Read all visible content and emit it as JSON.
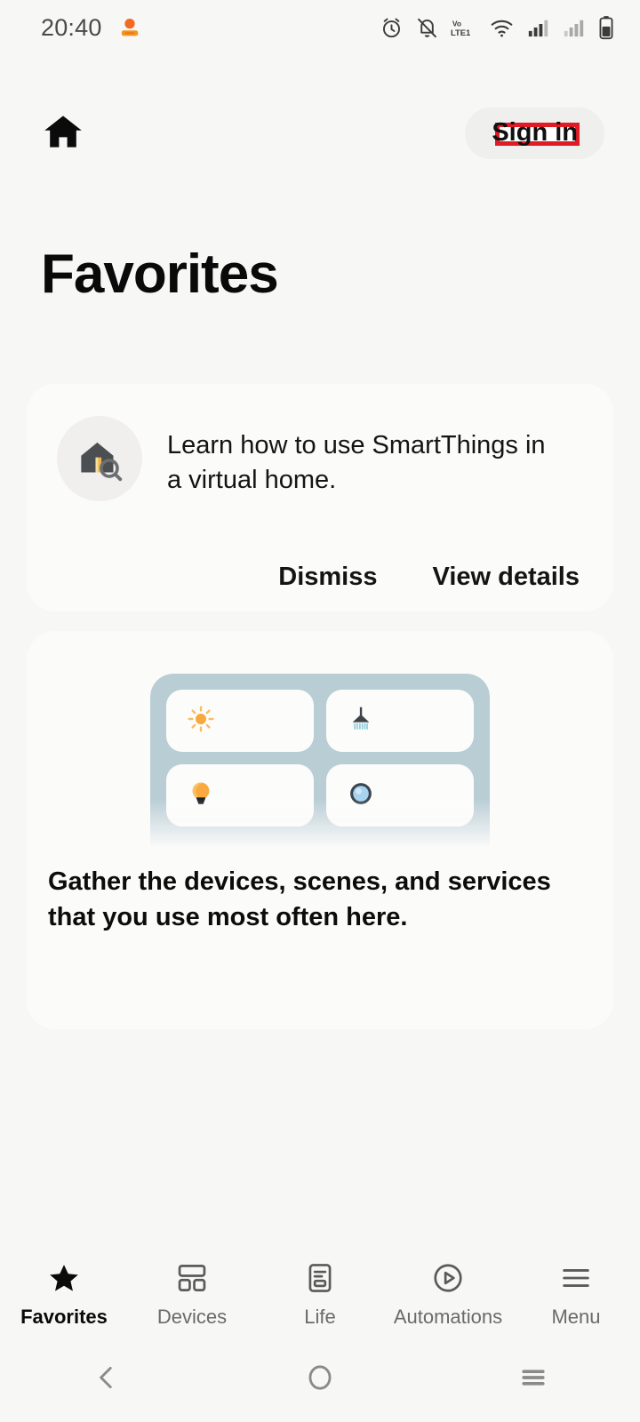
{
  "status_bar": {
    "time": "20:40",
    "icons": [
      "notification-orange-icon",
      "alarm-icon",
      "mute-icon",
      "volte1-icon",
      "wifi-icon",
      "signal-sim1-icon",
      "signal-sim2-icon",
      "battery-icon"
    ],
    "network_label": "Vo LTE1"
  },
  "app_bar": {
    "home_icon": "home-icon",
    "sign_in_label": "Sign in",
    "highlight_color": "#e01b24"
  },
  "page": {
    "title": "Favorites",
    "background": "#f7f7f5"
  },
  "tip_card": {
    "icon": "virtual-home-search-icon",
    "message": "Learn how to use SmartThings in a virtual home.",
    "dismiss_label": "Dismiss",
    "view_details_label": "View details"
  },
  "empty_card": {
    "illustration": {
      "container_color": "#b9cdd5",
      "cells": [
        {
          "icon": "sun-icon",
          "color": "#f5a623"
        },
        {
          "icon": "shower-head-icon",
          "color": "#3f4448"
        },
        {
          "icon": "light-bulb-icon",
          "color": "#f5a623"
        },
        {
          "icon": "sensor-button-icon",
          "color": "#9ec9e8"
        }
      ]
    },
    "caption": "Gather the devices, scenes, and services that you use most often here."
  },
  "bottom_nav": {
    "items": [
      {
        "label": "Favorites",
        "icon": "star-icon",
        "active": true
      },
      {
        "label": "Devices",
        "icon": "devices-grid-icon",
        "active": false
      },
      {
        "label": "Life",
        "icon": "life-card-icon",
        "active": false
      },
      {
        "label": "Automations",
        "icon": "play-circle-icon",
        "active": false
      },
      {
        "label": "Menu",
        "icon": "hamburger-menu-icon",
        "active": false
      }
    ]
  },
  "system_nav": {
    "back": "back-chevron-icon",
    "home": "home-circle-icon",
    "recents": "recents-lines-icon"
  }
}
